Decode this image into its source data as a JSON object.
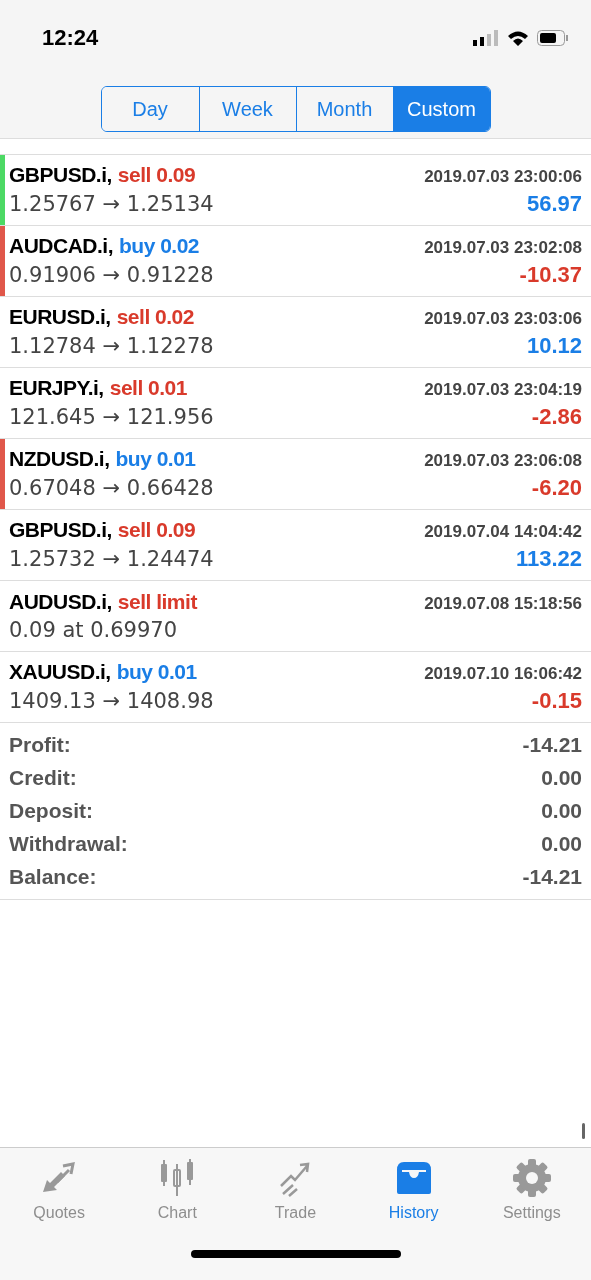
{
  "status_bar": {
    "time": "12:24"
  },
  "periods": [
    {
      "label": "Day",
      "selected": false
    },
    {
      "label": "Week",
      "selected": false
    },
    {
      "label": "Month",
      "selected": false
    },
    {
      "label": "Custom",
      "selected": true
    }
  ],
  "deals": [
    {
      "symbol": "GBPUSD.i,",
      "action": {
        "text": "sell 0.09",
        "color": "#d93a2b"
      },
      "time": "2019.07.03 23:00:06",
      "details": "1.25767 → 1.25134",
      "profit": {
        "text": "56.97",
        "color": "#1a7ee6"
      },
      "color": "#4cd964"
    },
    {
      "symbol": "AUDCAD.i,",
      "action": {
        "text": "buy 0.02",
        "color": "#1a7ee6"
      },
      "time": "2019.07.03 23:02:08",
      "details": "0.91906 → 0.91228",
      "profit": {
        "text": "-10.37",
        "color": "#d93a2b"
      },
      "color": "#e0574a"
    },
    {
      "symbol": "EURUSD.i,",
      "action": {
        "text": "sell 0.02",
        "color": "#d93a2b"
      },
      "time": "2019.07.03 23:03:06",
      "details": "1.12784 → 1.12278",
      "profit": {
        "text": "10.12",
        "color": "#1a7ee6"
      }
    },
    {
      "symbol": "EURJPY.i,",
      "action": {
        "text": "sell 0.01",
        "color": "#d93a2b"
      },
      "time": "2019.07.03 23:04:19",
      "details": "121.645 → 121.956",
      "profit": {
        "text": "-2.86",
        "color": "#d93a2b"
      }
    },
    {
      "symbol": "NZDUSD.i,",
      "action": {
        "text": "buy 0.01",
        "color": "#1a7ee6"
      },
      "time": "2019.07.03 23:06:08",
      "details": "0.67048 → 0.66428",
      "profit": {
        "text": "-6.20",
        "color": "#d93a2b"
      },
      "color": "#e0574a"
    },
    {
      "symbol": "GBPUSD.i,",
      "action": {
        "text": "sell 0.09",
        "color": "#d93a2b"
      },
      "time": "2019.07.04 14:04:42",
      "details": "1.25732 → 1.24474",
      "profit": {
        "text": "113.22",
        "color": "#1a7ee6"
      }
    },
    {
      "symbol": "AUDUSD.i,",
      "action": {
        "text": "sell limit",
        "color": "#d93a2b"
      },
      "time": "2019.07.08 15:18:56",
      "details": "0.09 at 0.69970"
    },
    {
      "symbol": "XAUUSD.i,",
      "action": {
        "text": "buy 0.01",
        "color": "#1a7ee6"
      },
      "time": "2019.07.10 16:06:42",
      "details": "1409.13 → 1408.98",
      "profit": {
        "text": "-0.15",
        "color": "#d93a2b"
      }
    }
  ],
  "summary": [
    {
      "label": "Profit:",
      "value": "-14.21"
    },
    {
      "label": "Credit:",
      "value": "0.00"
    },
    {
      "label": "Deposit:",
      "value": "0.00"
    },
    {
      "label": "Withdrawal:",
      "value": "0.00"
    },
    {
      "label": "Balance:",
      "value": "-14.21"
    }
  ],
  "tab_bar": [
    {
      "label": "Quotes",
      "kind": "quotes",
      "selected": false
    },
    {
      "label": "Chart",
      "kind": "chart",
      "selected": false
    },
    {
      "label": "Trade",
      "kind": "trade",
      "selected": false
    },
    {
      "label": "History",
      "kind": "history",
      "selected": true
    },
    {
      "label": "Settings",
      "kind": "settings",
      "selected": false
    }
  ]
}
